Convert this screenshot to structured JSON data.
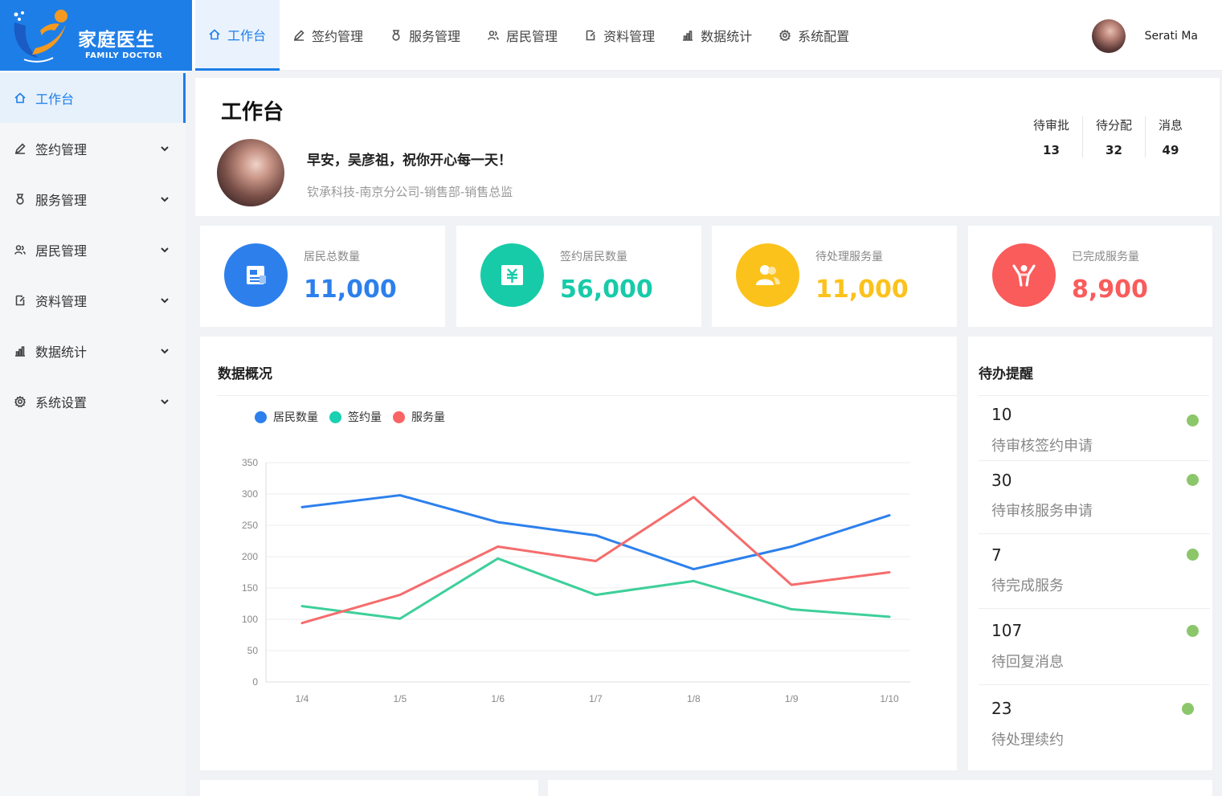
{
  "app": {
    "logo_cn": "家庭医生",
    "logo_en": "FAMILY DOCTOR"
  },
  "topnav": [
    {
      "label": "工作台",
      "icon": "home-icon"
    },
    {
      "label": "签约管理",
      "icon": "pencil-icon"
    },
    {
      "label": "服务管理",
      "icon": "medal-icon"
    },
    {
      "label": "居民管理",
      "icon": "users-icon"
    },
    {
      "label": "资料管理",
      "icon": "document-icon"
    },
    {
      "label": "数据统计",
      "icon": "bar-chart-icon"
    },
    {
      "label": "系统配置",
      "icon": "gear-icon"
    }
  ],
  "user": {
    "name": "Serati Ma"
  },
  "sidebar": [
    {
      "label": "工作台",
      "icon": "home-icon"
    },
    {
      "label": "签约管理",
      "icon": "pencil-icon"
    },
    {
      "label": "服务管理",
      "icon": "medal-icon"
    },
    {
      "label": "居民管理",
      "icon": "users-icon"
    },
    {
      "label": "资料管理",
      "icon": "document-icon"
    },
    {
      "label": "数据统计",
      "icon": "bar-chart-icon"
    },
    {
      "label": "系统设置",
      "icon": "gear-icon"
    }
  ],
  "header": {
    "title": "工作台",
    "greeting": "早安，吴彦祖，祝你开心每一天！",
    "org": "钦承科技-南京分公司-销售部-销售总监",
    "stats": [
      {
        "label": "待审批",
        "value": "13"
      },
      {
        "label": "待分配",
        "value": "32"
      },
      {
        "label": "消息",
        "value": "49"
      }
    ]
  },
  "metrics": [
    {
      "label": "居民总数量",
      "value": "11,000",
      "color": "#2d80ec",
      "icon": "id-card-icon"
    },
    {
      "label": "签约居民数量",
      "value": "56,000",
      "color": "#17cba9",
      "icon": "yuan-document-icon"
    },
    {
      "label": "待处理服务量",
      "value": "11,000",
      "color": "#fcc21c",
      "icon": "users-icon"
    },
    {
      "label": "已完成服务量",
      "value": "8,900",
      "color": "#fa5b5b",
      "icon": "cheer-person-icon"
    }
  ],
  "overview": {
    "title": "数据概况"
  },
  "chart_data": {
    "type": "line",
    "categories": [
      "1/4",
      "1/5",
      "1/6",
      "1/7",
      "1/8",
      "1/9",
      "1/10"
    ],
    "series": [
      {
        "name": "居民数量",
        "color": "#2d80ec",
        "values": [
          279,
          298,
          255,
          234,
          180,
          216,
          266
        ]
      },
      {
        "name": "签约量",
        "color": "#3ecf9a",
        "values": [
          121,
          101,
          197,
          139,
          161,
          116,
          104
        ]
      },
      {
        "name": "服务量",
        "color": "#f56c6c",
        "values": [
          94,
          139,
          216,
          193,
          295,
          155,
          175
        ]
      }
    ],
    "yticks": [
      "0",
      "50",
      "100",
      "150",
      "200",
      "250",
      "300",
      "350"
    ],
    "ylim": [
      0,
      350
    ],
    "grid": true,
    "legend": "top-left"
  },
  "todo": {
    "title": "待办提醒",
    "items": [
      {
        "count": "10",
        "label": "待审核签约申请"
      },
      {
        "count": "30",
        "label": "待审核服务申请"
      },
      {
        "count": "7",
        "label": "待完成服务"
      },
      {
        "count": "107",
        "label": "待回复消息"
      },
      {
        "count": "23",
        "label": "待处理续约"
      }
    ]
  }
}
